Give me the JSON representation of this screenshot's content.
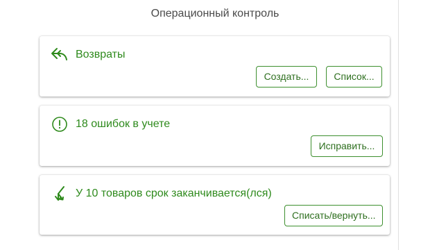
{
  "header": {
    "title": "Операционный контроль"
  },
  "cards": {
    "returns": {
      "icon": "return-arrow-icon",
      "label": "Возвраты",
      "buttons": {
        "create": "Создать...",
        "list": "Список..."
      }
    },
    "errors": {
      "icon": "exclamation-circle-icon",
      "label": "18 ошибок в учете",
      "buttons": {
        "fix": "Исправить..."
      }
    },
    "expiring": {
      "icon": "expiry-arrows-icon",
      "label": "У 10 товаров срок заканчивается(лся)",
      "buttons": {
        "writeoff": "Списать/вернуть..."
      }
    }
  },
  "colors": {
    "accent": "#2e8a1c",
    "button_border": "#3d8f2e",
    "title_text": "#4a4a4a"
  }
}
